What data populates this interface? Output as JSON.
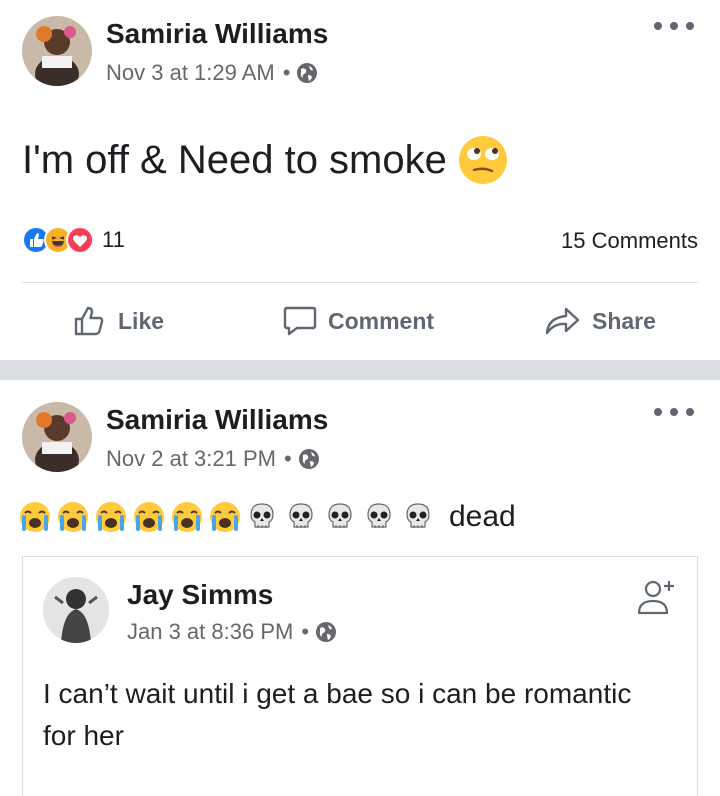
{
  "post1": {
    "author": "Samiria Williams",
    "timestamp": "Nov 3 at 1:29 AM",
    "privacy_icon": "globe-icon",
    "text": "I'm off & Need to smoke",
    "text_emoji": "face-with-rolling-eyes",
    "reaction_icons": [
      "like",
      "haha",
      "love"
    ],
    "reaction_count": "11",
    "comments_count": "15 Comments",
    "actions": {
      "like": "Like",
      "comment": "Comment",
      "share": "Share"
    }
  },
  "post2": {
    "author": "Samiria Williams",
    "timestamp": "Nov 2 at 3:21 PM",
    "privacy_icon": "globe-icon",
    "emojis": [
      "loudly-crying-face",
      "loudly-crying-face",
      "loudly-crying-face",
      "loudly-crying-face",
      "loudly-crying-face",
      "loudly-crying-face",
      "skull",
      "skull",
      "skull",
      "skull",
      "skull"
    ],
    "text": "dead",
    "shared_post": {
      "author": "Jay Simms",
      "timestamp": "Jan 3 at 8:36 PM",
      "privacy_icon": "globe-icon",
      "text": "I can’t wait until i get a bae so i can be romantic for her"
    }
  },
  "colors": {
    "like_blue": "#1877f2",
    "love_red": "#f33e58",
    "haha_yellow": "#f7b125",
    "secondary_text": "#65676b",
    "separator": "#dadde1"
  }
}
